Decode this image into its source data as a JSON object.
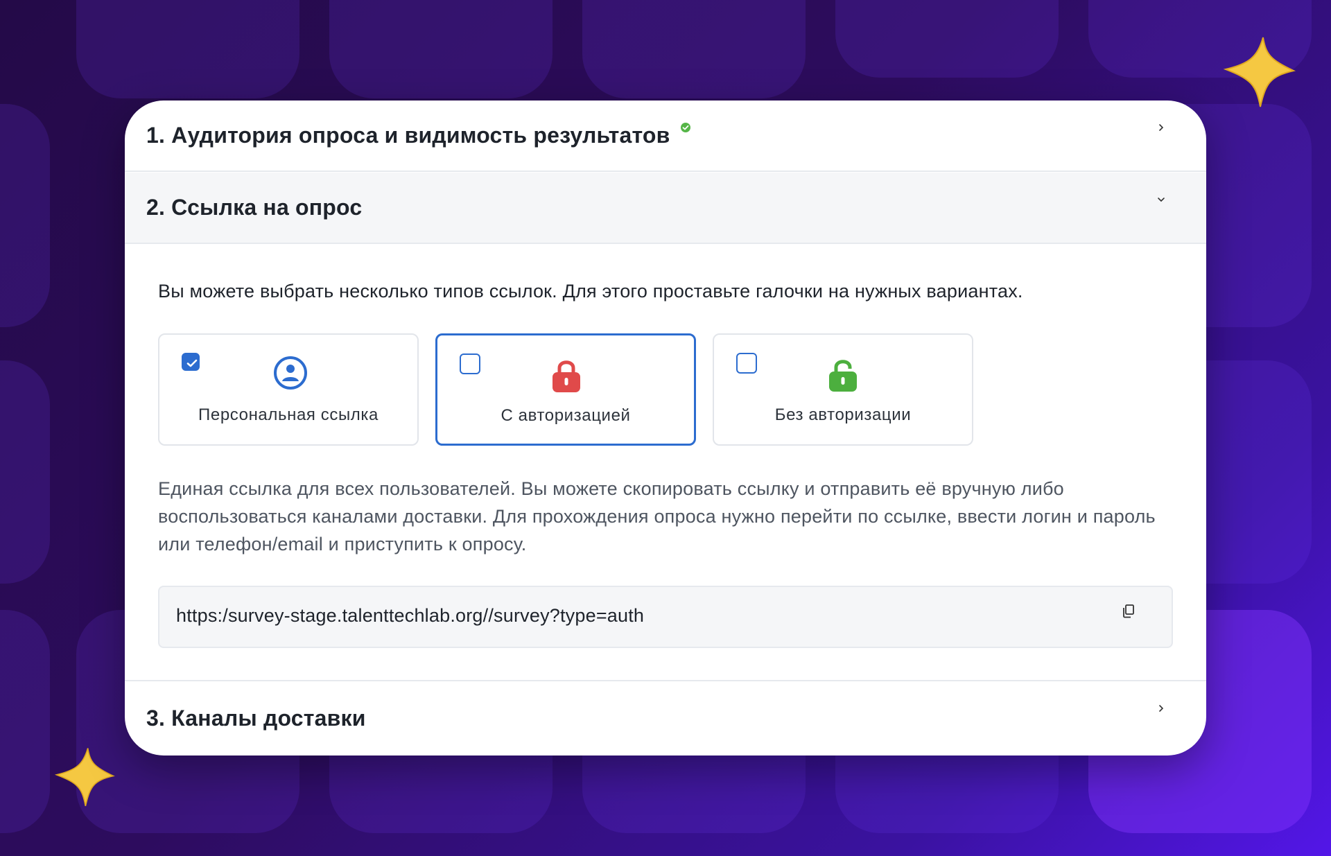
{
  "sections": [
    {
      "title": "1. Аудитория опроса и видимость результатов",
      "status_icon": "check-circle-icon",
      "state": "collapsed"
    },
    {
      "title": "2. Ссылка на опрос",
      "state": "expanded"
    },
    {
      "title": "3. Каналы доставки",
      "state": "collapsed"
    }
  ],
  "link_section": {
    "hint": "Вы можете выбрать несколько типов ссылок. Для этого проставьте галочки на нужных вариантах.",
    "options": [
      {
        "label": "Персональная ссылка",
        "checked": true,
        "selected": false,
        "icon": "person-circle-icon",
        "color": "#2c6ccf"
      },
      {
        "label": "С авторизацией",
        "checked": false,
        "selected": true,
        "icon": "lock-icon",
        "color": "#e04a4a"
      },
      {
        "label": "Без авторизации",
        "checked": false,
        "selected": false,
        "icon": "unlock-icon",
        "color": "#4caf3e"
      }
    ],
    "description": "Единая ссылка для всех пользователей. Вы можете скопировать ссылку и отправить её вручную либо воспользоваться каналами доставки. Для прохождения опроса нужно перейти по ссылке, ввести логин и пароль или телефон/email и приступить к опросу.",
    "url": "https:/survey-stage.talenttechlab.org//survey?type=auth",
    "copy_icon": "copy-icon"
  },
  "colors": {
    "accent": "#2c6ccf",
    "success": "#55b547",
    "background": "#2d0c5e"
  }
}
